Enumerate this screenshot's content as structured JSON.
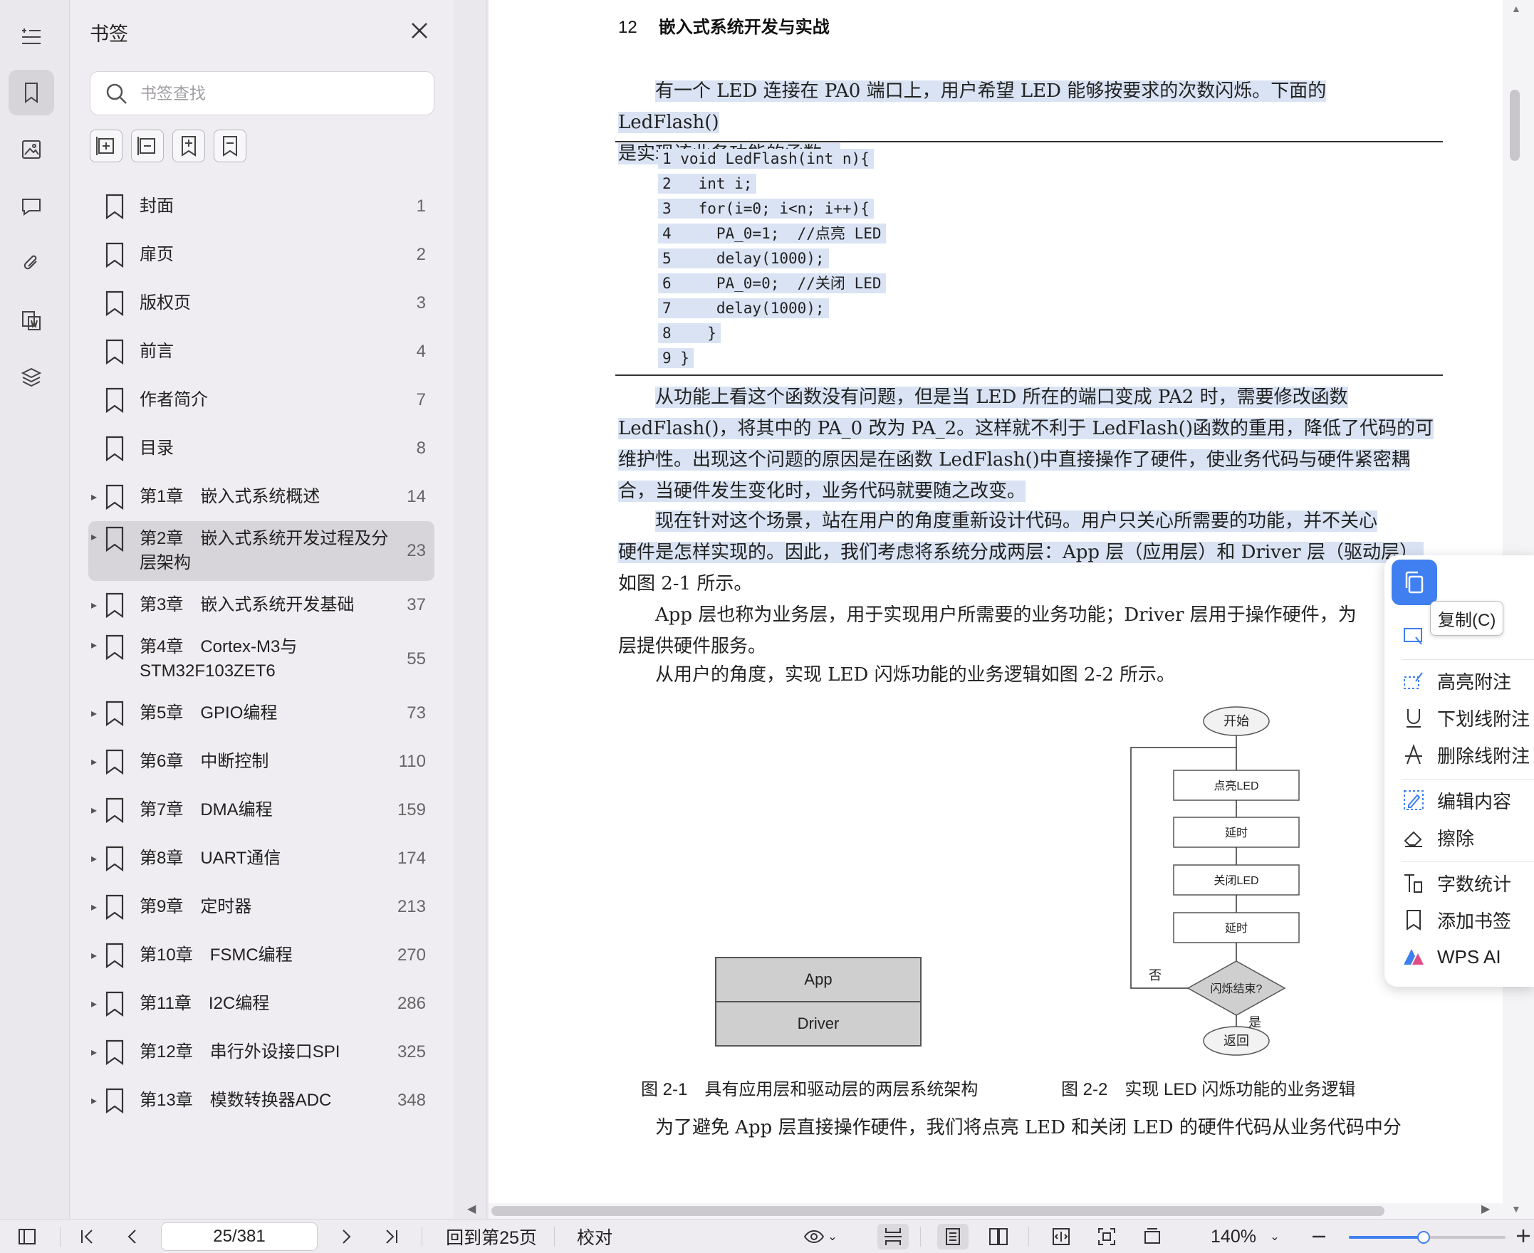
{
  "sidebar": {
    "title": "书签",
    "search_placeholder": "书签查找",
    "bookmarks": [
      {
        "label": "封面",
        "page": "1",
        "expandable": false
      },
      {
        "label": "扉页",
        "page": "2",
        "expandable": false
      },
      {
        "label": "版权页",
        "page": "3",
        "expandable": false
      },
      {
        "label": "前言",
        "page": "4",
        "expandable": false
      },
      {
        "label": "作者简介",
        "page": "7",
        "expandable": false
      },
      {
        "label": "目录",
        "page": "8",
        "expandable": false
      },
      {
        "label": "第1章　嵌入式系统概述",
        "page": "14",
        "expandable": true
      },
      {
        "label": "第2章　嵌入式系统开发过程及分",
        "label2": "层架构",
        "page": "23",
        "expandable": true,
        "selected": true
      },
      {
        "label": "第3章　嵌入式系统开发基础",
        "page": "37",
        "expandable": true
      },
      {
        "label": "第4章　Cortex-M3与",
        "label2": "STM32F103ZET6",
        "page": "55",
        "expandable": true
      },
      {
        "label": "第5章　GPIO编程",
        "page": "73",
        "expandable": true
      },
      {
        "label": "第6章　中断控制",
        "page": "110",
        "expandable": true
      },
      {
        "label": "第7章　DMA编程",
        "page": "159",
        "expandable": true
      },
      {
        "label": "第8章　UART通信",
        "page": "174",
        "expandable": true
      },
      {
        "label": "第9章　定时器",
        "page": "213",
        "expandable": true
      },
      {
        "label": "第10章　FSMC编程",
        "page": "270",
        "expandable": true
      },
      {
        "label": "第11章　I2C编程",
        "page": "286",
        "expandable": true
      },
      {
        "label": "第12章　串行外设接口SPI",
        "page": "325",
        "expandable": true
      },
      {
        "label": "第13章　模数转换器ADC",
        "page": "348",
        "expandable": true
      }
    ]
  },
  "document": {
    "header_page": "12",
    "header_title": "嵌入式系统开发与实战",
    "para1_line1": "有一个 LED 连接在 PA0 端口上，用户希望 LED 能够按要求的次数闪烁。下面的 LedFlash()",
    "para1_line2": "是实现该业务功能的函数。",
    "code": [
      "1 void LedFlash(int n){",
      "2   int i;",
      "3   for(i=0; i<n; i++){",
      "4     PA_0=1;  //点亮 LED",
      "5     delay(1000);",
      "6     PA_0=0;  //关闭 LED",
      "7     delay(1000);",
      "8    }",
      "9 }"
    ],
    "para2": [
      "从功能上看这个函数没有问题，但是当 LED 所在的端口变成 PA2 时，需要修改函数",
      "LedFlash()，将其中的 PA_0 改为 PA_2。这样就不利于 LedFlash()函数的重用，降低了代码的可",
      "维护性。出现这个问题的原因是在函数 LedFlash()中直接操作了硬件，使业务代码与硬件紧密耦",
      "合，当硬件发生变化时，业务代码就要随之改变。"
    ],
    "para3": [
      "现在针对这个场景，站在用户的角度重新设计代码。用户只关心所需要的功能，并不关心",
      "硬件是怎样实现的。因此，我们考虑将系统分成两层：App 层（应用层）和 Driver 层（驱动层）,"
    ],
    "para3_line3": "如图 2-1 所示。",
    "para4": [
      "App 层也称为业务层，用于实现用户所需要的业务功能；Driver 层用于操作硬件，为",
      "层提供硬件服务。"
    ],
    "para5": "从用户的角度，实现 LED 闪烁功能的业务逻辑如图 2-2 所示。",
    "fig1_app": "App",
    "fig1_driver": "Driver",
    "flow": {
      "start": "开始",
      "s1": "点亮LED",
      "s2": "延时",
      "s3": "关闭LED",
      "s4": "延时",
      "decision": "闪烁结束?",
      "no": "否",
      "yes": "是",
      "end": "返回"
    },
    "caption1": "图 2-1　具有应用层和驱动层的两层系统架构",
    "caption2": "图 2-2　实现 LED 闪烁功能的业务逻辑",
    "para6": "为了避免 App 层直接操作硬件，我们将点亮 LED 和关闭 LED 的硬件代码从业务代码中分"
  },
  "context_menu": {
    "copy_tooltip": "复制(C)",
    "items": [
      "高亮附注",
      "下划线附注",
      "删除线附注",
      "编辑内容",
      "擦除",
      "字数统计",
      "添加书签",
      "WPS AI"
    ]
  },
  "toolbar": {
    "page_value": "25/381",
    "back_to_page": "回到第25页",
    "proofread": "校对",
    "zoom": "140%"
  },
  "colors": {
    "accent": "#3f7ff0",
    "selection": "#d9e3f3",
    "selected_bookmark": "#d8d5da"
  }
}
